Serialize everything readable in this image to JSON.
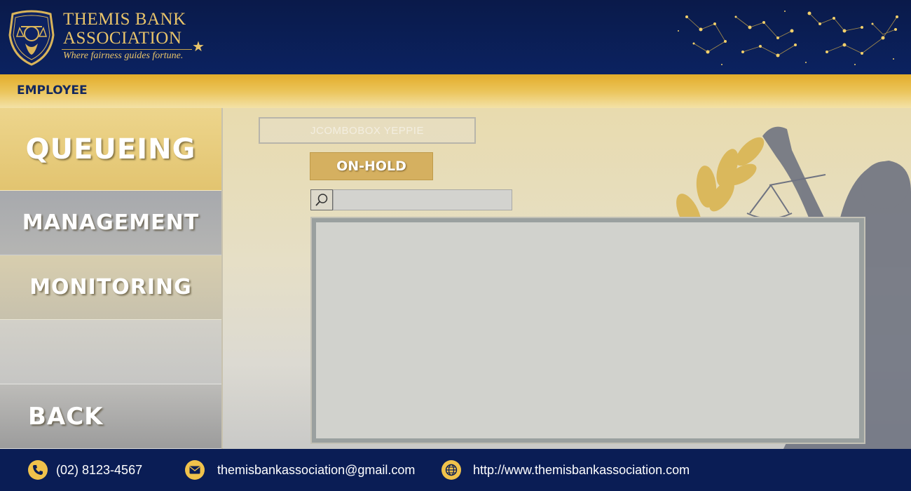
{
  "header": {
    "brand_line1": "THEMIS BANK",
    "brand_line2": "ASSOCIATION",
    "tagline": "Where fairness guides fortune."
  },
  "role_bar": {
    "label": "EMPLOYEE"
  },
  "sidebar": {
    "items": [
      {
        "label": "QUEUEING",
        "active": true
      },
      {
        "label": "MANAGEMENT"
      },
      {
        "label": "MONITORING"
      },
      {
        "label": ""
      },
      {
        "label": "BACK"
      }
    ]
  },
  "main": {
    "combo_value": "JCOMBOBOX YEPPIE",
    "onhold_label": "ON-HOLD",
    "search": {
      "value": "",
      "placeholder": ""
    }
  },
  "footer": {
    "phone": "(02) 8123-4567",
    "email": "themisbankassociation@gmail.com",
    "website": "http://www.themisbankassociation.com"
  },
  "colors": {
    "navy": "#0a1d55",
    "gold": "#e9c46a",
    "accent_gold": "#e3ad2a"
  },
  "icons": [
    "scales-badge-icon",
    "star-icon",
    "constellation-graphic",
    "search-icon",
    "phone-icon",
    "mail-icon",
    "globe-icon"
  ]
}
